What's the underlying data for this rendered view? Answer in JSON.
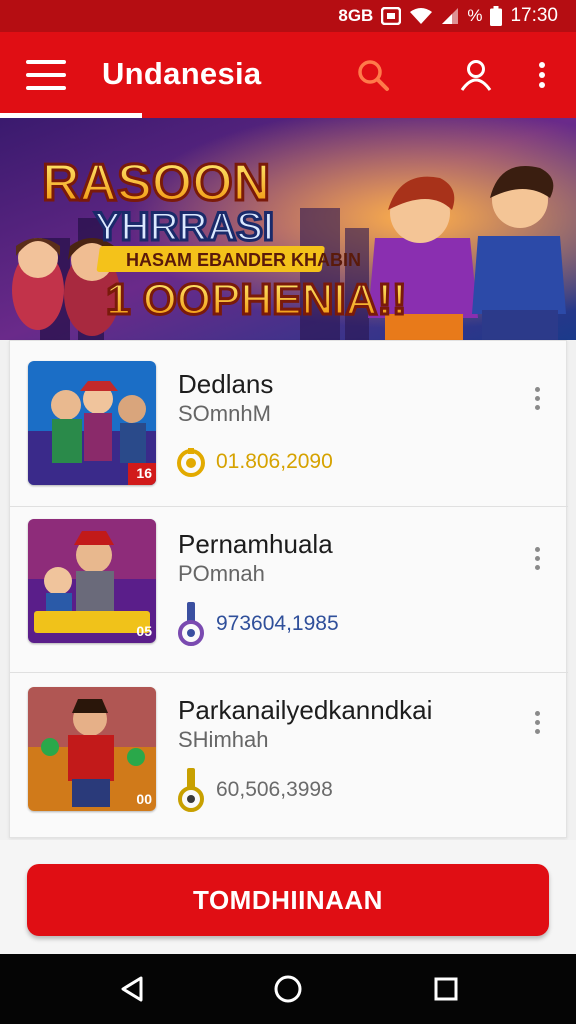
{
  "status_bar": {
    "left_text": "8GB",
    "battery_text": "%",
    "time": "17:30",
    "icons": [
      "notification-icon",
      "wifi-icon",
      "signal-icon",
      "battery-icon"
    ]
  },
  "app_bar": {
    "title": "Undanesia",
    "icons": [
      "menu-icon",
      "search-icon",
      "account-icon",
      "more-vert-icon"
    ],
    "accent_color": "#e00e14"
  },
  "banner": {
    "line1": "RASOON",
    "line2": "YHRRASI",
    "line3": "HASAM EBANDER KHABIN",
    "line4": "1 OOPHENIA!!"
  },
  "list": {
    "items": [
      {
        "title": "Dedlans",
        "subtitle": "SOmnhM",
        "stat": "01.806,2090",
        "stat_icon": "coin-icon",
        "stat_color": "#d6a200",
        "badge": "16"
      },
      {
        "title": "Pernamhuala",
        "subtitle": "POmnah",
        "stat": "973604,1985",
        "stat_icon": "wrench-icon",
        "stat_color": "#2f4f9a",
        "badge": "05"
      },
      {
        "title": "Parkanailyedkanndkai",
        "subtitle": "SHimhah",
        "stat": "60,506,3998",
        "stat_icon": "key-icon",
        "stat_color": "#6a6a6a",
        "badge": "00"
      }
    ]
  },
  "cta": {
    "label": "TOMDHIINAAN"
  },
  "nav_bar": {
    "icons": [
      "back-icon",
      "home-icon",
      "recents-icon"
    ]
  }
}
